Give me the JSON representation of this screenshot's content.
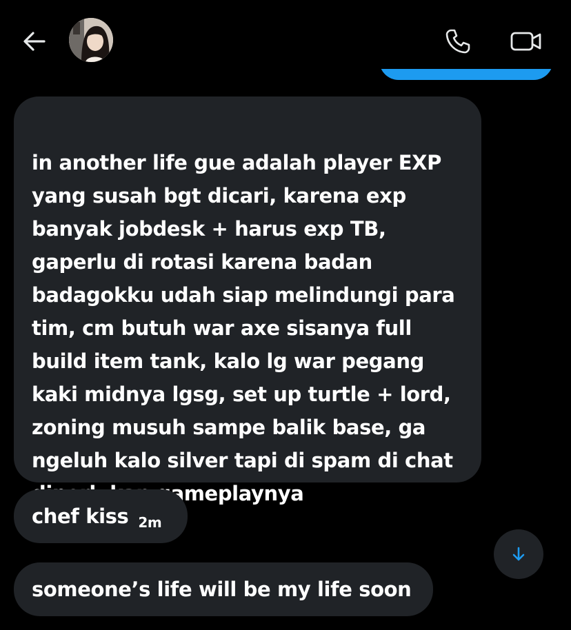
{
  "header": {
    "back_icon": "arrow-left-icon",
    "avatar_icon": "user-avatar",
    "call_icon": "phone-icon",
    "video_icon": "video-camera-icon"
  },
  "messages": [
    {
      "text": "in another life gue adalah player EXP\nyang susah bgt dicari, karena exp\nbanyak jobdesk + harus exp TB,\ngaperlu di rotasi karena badan\nbadagokku udah siap melindungi para\ntim, cm butuh war axe sisanya full\nbuild item tank, kalo lg war pegang\nkaki midnya lgsg, set up turtle + lord,\nzoning musuh sampe balik base, ga\nngeluh kalo silver tapi di spam di chat\ndiperlukan gameplaynya"
    },
    {
      "text": "chef kiss",
      "time": "2m"
    },
    {
      "text": "someone’s life will be my life soon"
    }
  ],
  "scroll_down_icon": "arrow-down-icon",
  "colors": {
    "background": "#000000",
    "bubble": "#202327",
    "accent": "#1d9bf0",
    "icon": "#e7e9ea"
  }
}
